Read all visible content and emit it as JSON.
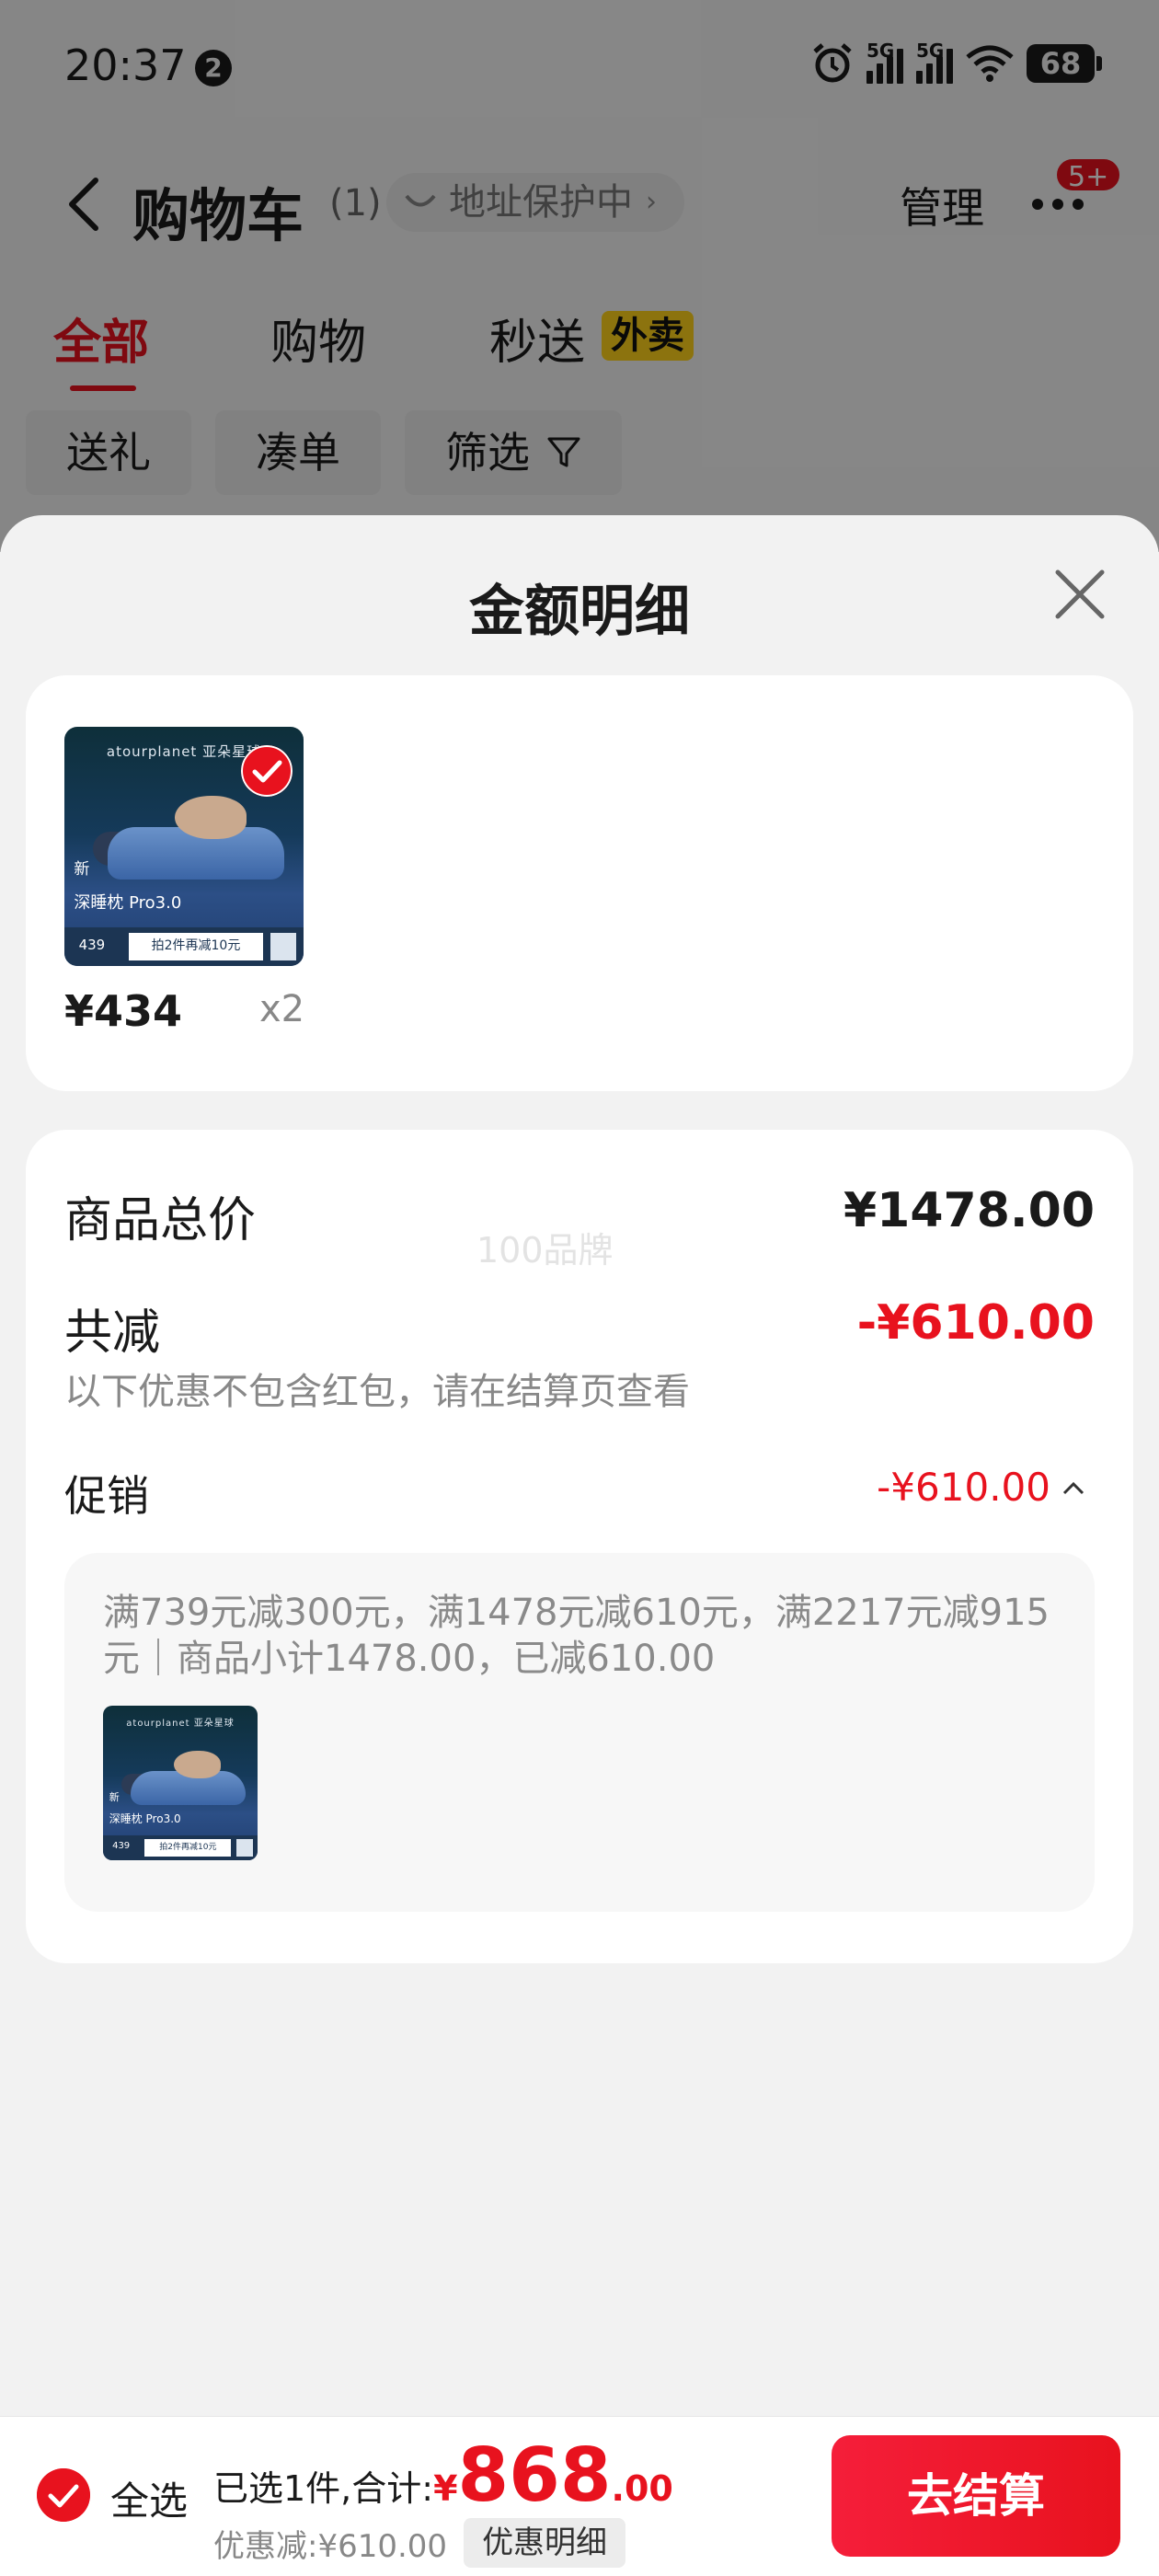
{
  "status_bar": {
    "time": "20:37",
    "notification_count": "2",
    "network_1": "5G",
    "network_2": "5G",
    "battery": "68"
  },
  "nav": {
    "title": "购物车",
    "count": "(1)",
    "address_status": "地址保护中",
    "manage": "管理",
    "message_badge": "5+"
  },
  "tabs": [
    {
      "label": "全部",
      "active": true
    },
    {
      "label": "购物",
      "active": false
    },
    {
      "label": "秒送",
      "active": false,
      "badge": "外卖"
    }
  ],
  "filters": [
    "送礼",
    "凑单",
    "筛选"
  ],
  "sheet": {
    "title": "金额明细",
    "product": {
      "brand": "atourplanet 亚朵星球",
      "new_tag": "新",
      "model": "深睡枕 Pro3.0",
      "thumb_price": "439",
      "thumb_promo": "拍2件再减10元",
      "price": "¥434",
      "quantity": "x2"
    },
    "summary": {
      "total_label": "商品总价",
      "total_value": "¥1478.00",
      "watermark": "100品牌",
      "discount_label": "共减",
      "discount_value": "-¥610.00",
      "discount_note": "以下优惠不包含红包，请在结算页查看",
      "promo_label": "促销",
      "promo_value": "-¥610.00",
      "promo_detail": "满739元减300元，满1478元减610元，满2217元减915元｜商品小计1478.00，已减610.00"
    }
  },
  "action_bar": {
    "select_all": "全选",
    "total_prefix": "已选1件,合计:",
    "total_yen": "¥",
    "total_integer": "868",
    "total_decimal": ".00",
    "discount_text": "优惠减:¥610.00",
    "detail_button": "优惠明细",
    "checkout_button": "去结算"
  },
  "colors": {
    "accent": "#e8121e",
    "tab_badge": "#ffd21a",
    "sheet_bg": "#f2f2f2"
  }
}
